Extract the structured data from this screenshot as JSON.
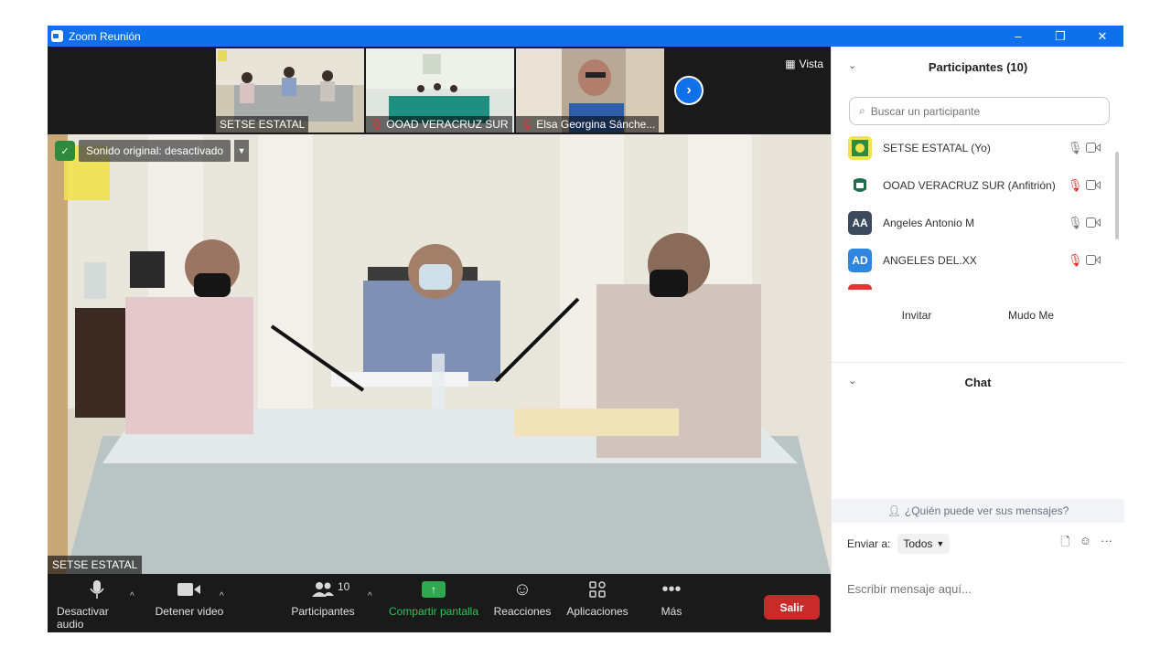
{
  "window": {
    "title": "Zoom Reunión",
    "controls": [
      "–",
      "❐",
      "✕"
    ]
  },
  "thumbnails": [
    {
      "name": "SETSE ESTATAL",
      "muted": false
    },
    {
      "name": "OOAD VERACRUZ SUR",
      "muted": true
    },
    {
      "name": "Elsa Georgina Sánche...",
      "muted": true
    }
  ],
  "view_label": "Vista",
  "main_video": {
    "sound_banner": "Sonido original: desactivado",
    "speaker_name": "SETSE ESTATAL"
  },
  "toolbar": {
    "mute_label": "Desactivar audio",
    "video_label": "Detener video",
    "participants_label": "Participantes",
    "participants_count": "10",
    "share_label": "Compartir pantalla",
    "reactions_label": "Reacciones",
    "apps_label": "Aplicaciones",
    "more_label": "Más",
    "leave_label": "Salir"
  },
  "participants_panel": {
    "title": "Participantes (10)",
    "search_placeholder": "Buscar un participante",
    "items": [
      {
        "name": "SETSE ESTATAL (Yo)",
        "mic": "on",
        "avatar_type": "logo"
      },
      {
        "name": "OOAD VERACRUZ SUR (Anfitrión)",
        "mic": "off",
        "avatar_type": "logo"
      },
      {
        "name": "Angeles Antonio M",
        "mic": "on",
        "initials": "AA",
        "color": "#3b4a5c"
      },
      {
        "name": "ANGELES DEL.XX",
        "mic": "off",
        "initials": "AD",
        "color": "#2e86de"
      }
    ],
    "invite_label": "Invitar",
    "mute_me_label": "Mudo Me"
  },
  "chat_panel": {
    "title": "Chat",
    "who_can_see": "¿Quién puede ver sus mensajes?",
    "send_to_label": "Enviar a:",
    "send_to_value": "Todos",
    "input_placeholder": "Escribir mensaje aquí..."
  },
  "colors": {
    "titlebar": "#0e71eb",
    "leave": "#c92a2a",
    "share": "#2fa84f",
    "mic_off": "#e0312f"
  }
}
